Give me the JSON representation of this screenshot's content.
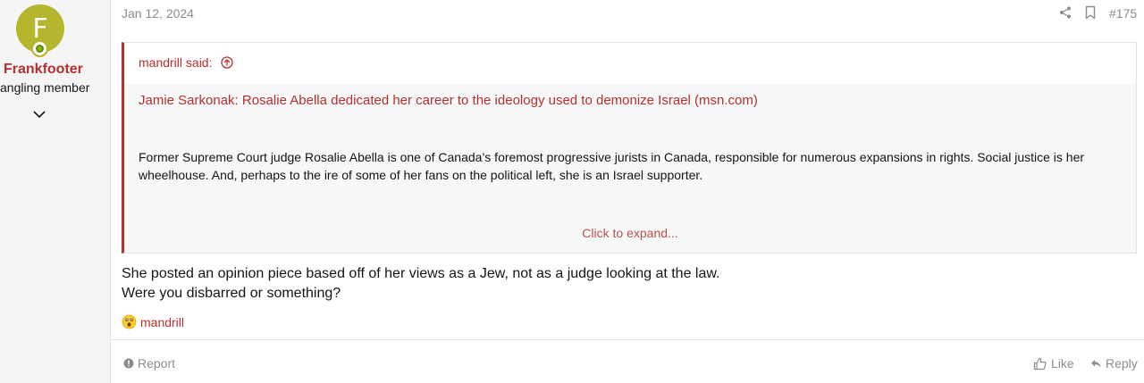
{
  "user": {
    "avatar_letter": "F",
    "avatar_color": "#b5b52e",
    "name": "Frankfooter",
    "title": "angling member"
  },
  "post": {
    "date": "Jan 12, 2024",
    "number": "#175"
  },
  "quote": {
    "author": "mandrill said:",
    "link_text": "Jamie Sarkonak: Rosalie Abella dedicated her career to the ideology used to demonize Israel (msn.com)",
    "body": "Former Supreme Court judge Rosalie Abella is one of Canada’s foremost progressive jurists in Canada, responsible for numerous expansions in rights. Social justice is her wheelhouse. And, perhaps to the ire of some of her fans on the political left, she is an Israel supporter.",
    "expand_label": "Click to expand..."
  },
  "message": {
    "line1": "She posted an opinion piece based off of her views as a Jew, not as a judge looking at the law.",
    "line2": "Were you disbarred or something?"
  },
  "reactions": {
    "emoji": "wow-face",
    "user": "mandrill"
  },
  "actions": {
    "report": "Report",
    "like": "Like",
    "reply": "Reply"
  },
  "colors": {
    "accent": "#b72e2e",
    "muted": "#8c8c8c",
    "online": "#7fb900"
  }
}
